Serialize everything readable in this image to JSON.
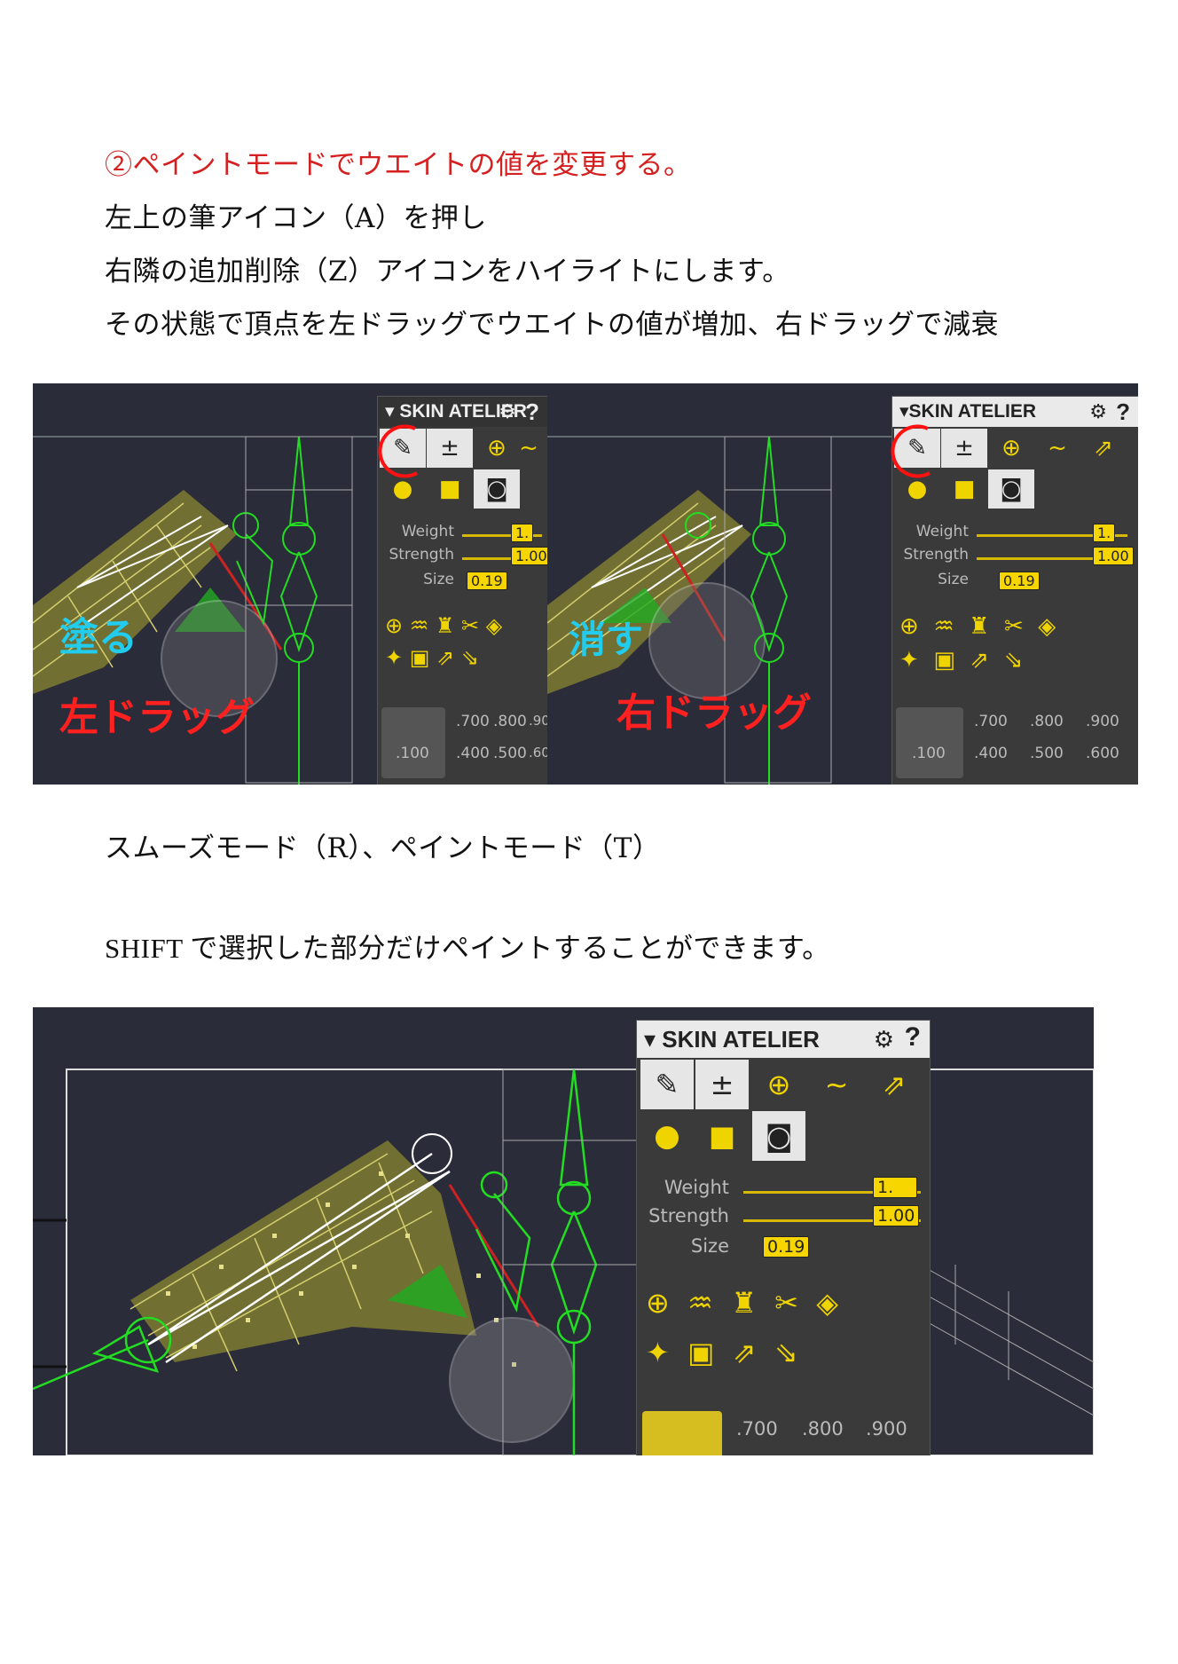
{
  "text": {
    "l1": "②ペイントモードでウエイトの値を変更する。",
    "l2": "左上の筆アイコン（A）を押し",
    "l3": "右隣の追加削除（Z）アイコンをハイライトにします。",
    "l4": " その状態で頂点を左ドラッグでウエイトの値が増加、右ドラッグで減衰",
    "l5": "スムーズモード（R）、ペイントモード（T）",
    "l6": "SHIFT で選択した部分だけペイントすることができます。"
  },
  "panel": {
    "title": "▾ SKIN ATELIER",
    "title2": "▾SKIN ATELIER",
    "gear": "⚙",
    "help": "?",
    "weight_label": "Weight",
    "strength_label": "Strength",
    "size_label": "Size",
    "weight_value": "1.",
    "strength_value": "1.00",
    "size_value": "0.19",
    "presets_top": [
      ".700",
      ".800",
      ".900"
    ],
    "presets_bottom": [
      ".100",
      ".400",
      ".500",
      ".600"
    ]
  },
  "annotations": {
    "paint": "塗る",
    "left_drag": "左ドラッグ",
    "erase": "消す",
    "right_drag": "右ドラッグ"
  },
  "colors": {
    "accent": "#f7d600",
    "bone_green": "#22dd22",
    "mesh_yellow": "#c8c050",
    "annotation_red": "#ff2020",
    "annotation_cyan": "#22ccee"
  },
  "icons": [
    "brush-icon",
    "add-remove-icon",
    "target-icon",
    "smooth-icon",
    "pick-icon",
    "circle-brush-icon",
    "square-brush-icon",
    "camera-icon"
  ]
}
